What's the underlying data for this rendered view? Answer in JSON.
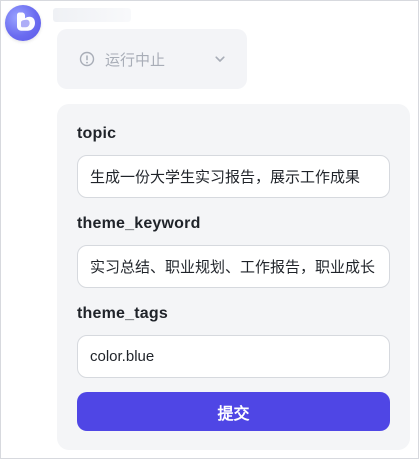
{
  "status": {
    "label": "运行中止",
    "icons": {
      "left": "info-circle-icon",
      "right": "chevron-down-icon"
    }
  },
  "form": {
    "fields": [
      {
        "label": "topic",
        "value": "生成一份大学生实习报告，展示工作成果"
      },
      {
        "label": "theme_keyword",
        "value": "实习总结、职业规划、工作报告，职业成长"
      },
      {
        "label": "theme_tags",
        "value": "color.blue"
      }
    ],
    "submit_label": "提交"
  },
  "colors": {
    "accent": "#4f46e5",
    "card_bg": "#f4f5f7",
    "status_bg": "#f3f4f7"
  }
}
